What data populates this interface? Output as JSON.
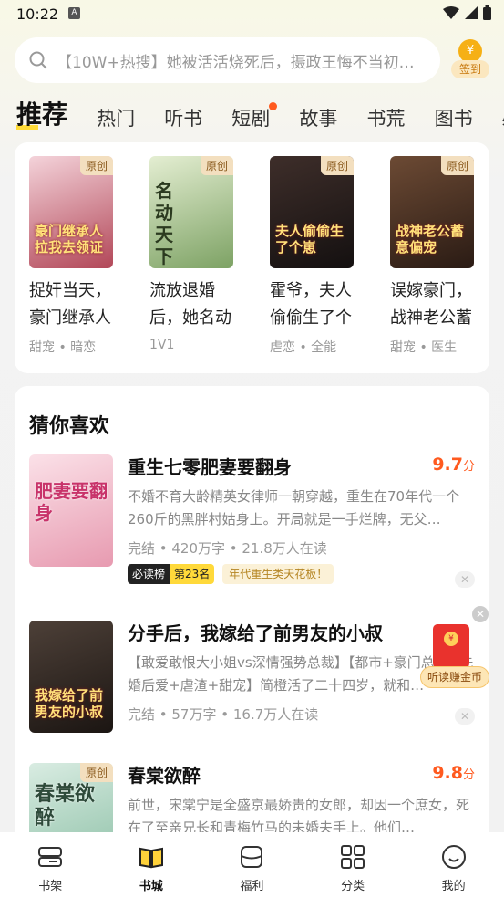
{
  "status_bar": {
    "time": "10:22",
    "notification_letter": "A"
  },
  "search": {
    "placeholder": "【10W+热搜】她被活活烧死后，摄政王悔不当初…"
  },
  "signin": {
    "label": "签到",
    "coin_glyph": "¥"
  },
  "tabs": [
    {
      "label": "推荐",
      "active": true
    },
    {
      "label": "热门"
    },
    {
      "label": "听书"
    },
    {
      "label": "短剧",
      "dot": true
    },
    {
      "label": "故事"
    },
    {
      "label": "书荒"
    },
    {
      "label": "图书"
    },
    {
      "label": "必读"
    }
  ],
  "recommend": [
    {
      "badge": "原创",
      "cover_text": "豪门继承人拉我去领证",
      "title": "捉奸当天，豪门继承人",
      "tags": "甜宠 • 暗恋",
      "colors": [
        "#f4d3da",
        "#b24758"
      ]
    },
    {
      "badge": "原创",
      "cover_text": "名动天下",
      "title": "流放退婚后，她名动",
      "tags": "1V1",
      "colors": [
        "#e4eed2",
        "#7da264"
      ]
    },
    {
      "badge": "原创",
      "cover_text": "夫人偷偷生了个崽",
      "title": "霍爷，夫人偷偷生了个",
      "tags": "虐恋 • 全能",
      "colors": [
        "#3e2e2a",
        "#141010"
      ]
    },
    {
      "badge": "原创",
      "cover_text": "战神老公蓄意偏宠",
      "title": "误嫁豪门，战神老公蓄",
      "tags": "甜宠 • 医生",
      "colors": [
        "#6c4a34",
        "#2a1b14"
      ]
    }
  ],
  "guess": {
    "heading": "猜你喜欢",
    "items": [
      {
        "cover_text": "肥妻要翻身",
        "badge": "",
        "title": "重生七零肥妻要翻身",
        "score": "9.7",
        "score_unit": "分",
        "desc": "不婚不育大龄精英女律师一朝穿越，重生在70年代一个260斤的黑胖村姑身上。开局就是一手烂牌，无父…",
        "meta": "完结 • 420万字 • 21.8万人在读",
        "rank_a": "必读榜",
        "rank_b": "第23名",
        "hot": "年代重生类天花板！",
        "colors": [
          "#fbe1e8",
          "#e79ab0"
        ]
      },
      {
        "cover_text": "我嫁给了前男友的小叔",
        "badge": "",
        "title": "分手后，我嫁给了前男友的小叔",
        "score": "",
        "score_unit": "",
        "desc": "【敢爱敢恨大小姐vs深情强势总裁】【都市+豪门总裁+先婚后爱+虐渣+甜宠】简橙活了二十四岁，就和…",
        "meta": "完结 • 57万字 • 16.7万人在读",
        "colors": [
          "#4d4038",
          "#1b1512"
        ]
      },
      {
        "cover_text": "春棠欲醉",
        "badge": "原创",
        "title": "春棠欲醉",
        "score": "9.8",
        "score_unit": "分",
        "desc": "前世，宋棠宁是全盛京最娇贵的女郎，却因一个庶女，死在了至亲兄长和青梅竹马的未婚夫手上。他们…",
        "meta": "",
        "colors": [
          "#d9ece2",
          "#8bbfa5"
        ]
      }
    ]
  },
  "packet": {
    "label": "听读赚金币"
  },
  "bottom_nav": [
    {
      "label": "书架",
      "icon": "bookshelf-icon"
    },
    {
      "label": "书城",
      "icon": "bookstore-icon",
      "active": true
    },
    {
      "label": "福利",
      "icon": "welfare-icon"
    },
    {
      "label": "分类",
      "icon": "category-icon"
    },
    {
      "label": "我的",
      "icon": "profile-icon"
    }
  ],
  "accent_color": "#ff5a1f"
}
